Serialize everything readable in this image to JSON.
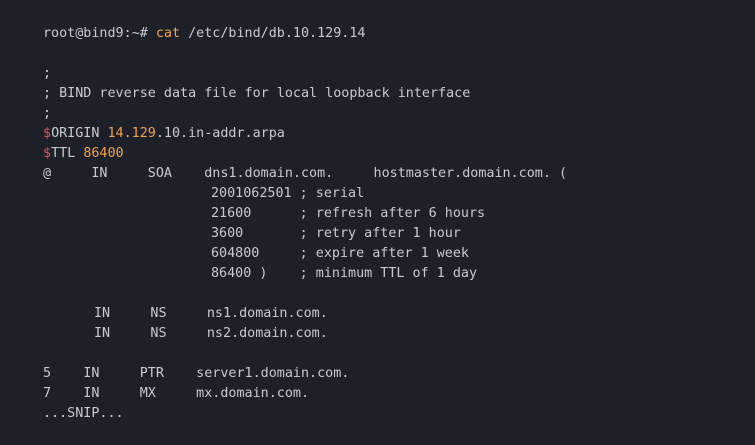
{
  "terminal": {
    "prompt": "root@bind9:~#",
    "command_name": "cat",
    "command_arg": "/etc/bind/db.10.129.14"
  },
  "file": {
    "comment_1": ";",
    "comment_2": "; BIND reverse data file for local loopback interface",
    "comment_3": ";",
    "origin_dollar": "$",
    "origin_key": "ORIGIN",
    "origin_highlight": "14.129",
    "origin_rest": ".10.in-addr.arpa",
    "ttl_dollar": "$",
    "ttl_key": "TTL",
    "ttl_value": "86400",
    "soa_line": "@     IN     SOA    dns1.domain.com.     hostmaster.domain.com. (",
    "serial_line": "2001062501 ; serial",
    "refresh_line": "21600      ; refresh after 6 hours",
    "retry_line": "3600       ; retry after 1 hour",
    "expire_line": "604800     ; expire after 1 week",
    "minimum_line": "86400 )    ; minimum TTL of 1 day",
    "ns1_line": "IN     NS     ns1.domain.com.",
    "ns2_line": "IN     NS     ns2.domain.com.",
    "ptr_line": "5    IN     PTR    server1.domain.com.",
    "mx_line": "7    IN     MX     mx.domain.com.",
    "snip_line": "...SNIP..."
  }
}
